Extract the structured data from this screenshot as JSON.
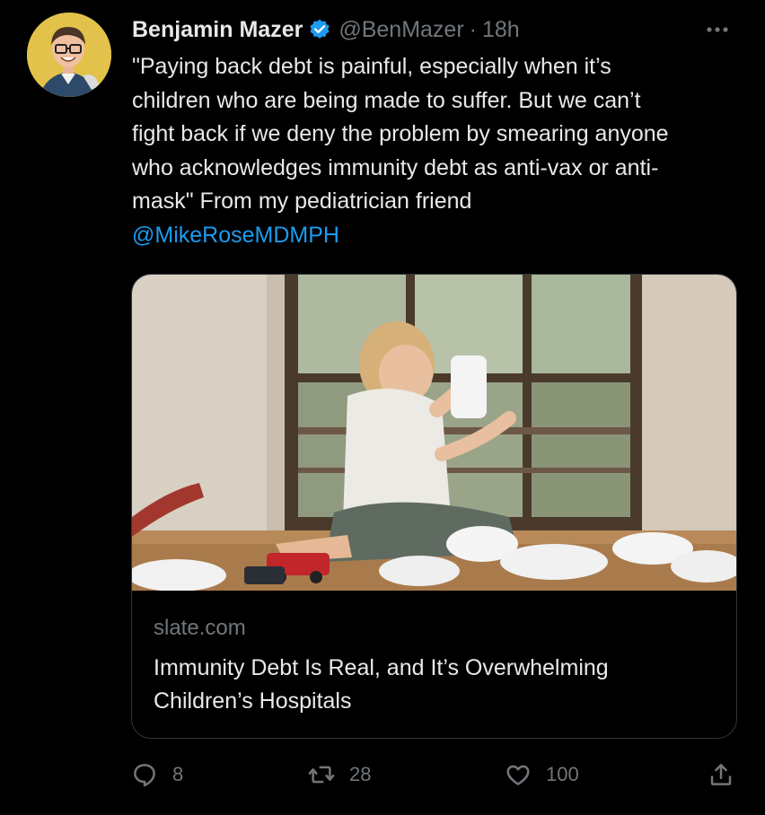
{
  "tweet": {
    "author_name": "Benjamin Mazer",
    "handle": "@BenMazer",
    "separator": "·",
    "time": "18h",
    "text_lines": [
      "\"Paying back debt is painful, especially when it’s",
      "children who are being made to suffer. But we can’t",
      "fight back if we deny the problem by smearing anyone",
      "who acknowledges immunity debt as anti-vax or anti-",
      "mask\" From my pediatrician friend"
    ],
    "mention": "@MikeRoseMDMPH"
  },
  "card": {
    "domain": "slate.com",
    "title_lines": [
      "Immunity Debt Is Real, and It’s Overwhelming",
      "Children’s Hospitals"
    ]
  },
  "actions": {
    "replies": "8",
    "retweets": "28",
    "likes": "100"
  },
  "icons": {
    "verified": "verified-badge-icon",
    "more": "more-options-icon",
    "reply": "reply-icon",
    "retweet": "retweet-icon",
    "like": "heart-icon",
    "share": "share-icon"
  },
  "colors": {
    "background": "#000000",
    "text": "#e7e9ea",
    "secondary": "#71767b",
    "link": "#1d9bf0",
    "avatar_bg": "#e2c24a"
  }
}
